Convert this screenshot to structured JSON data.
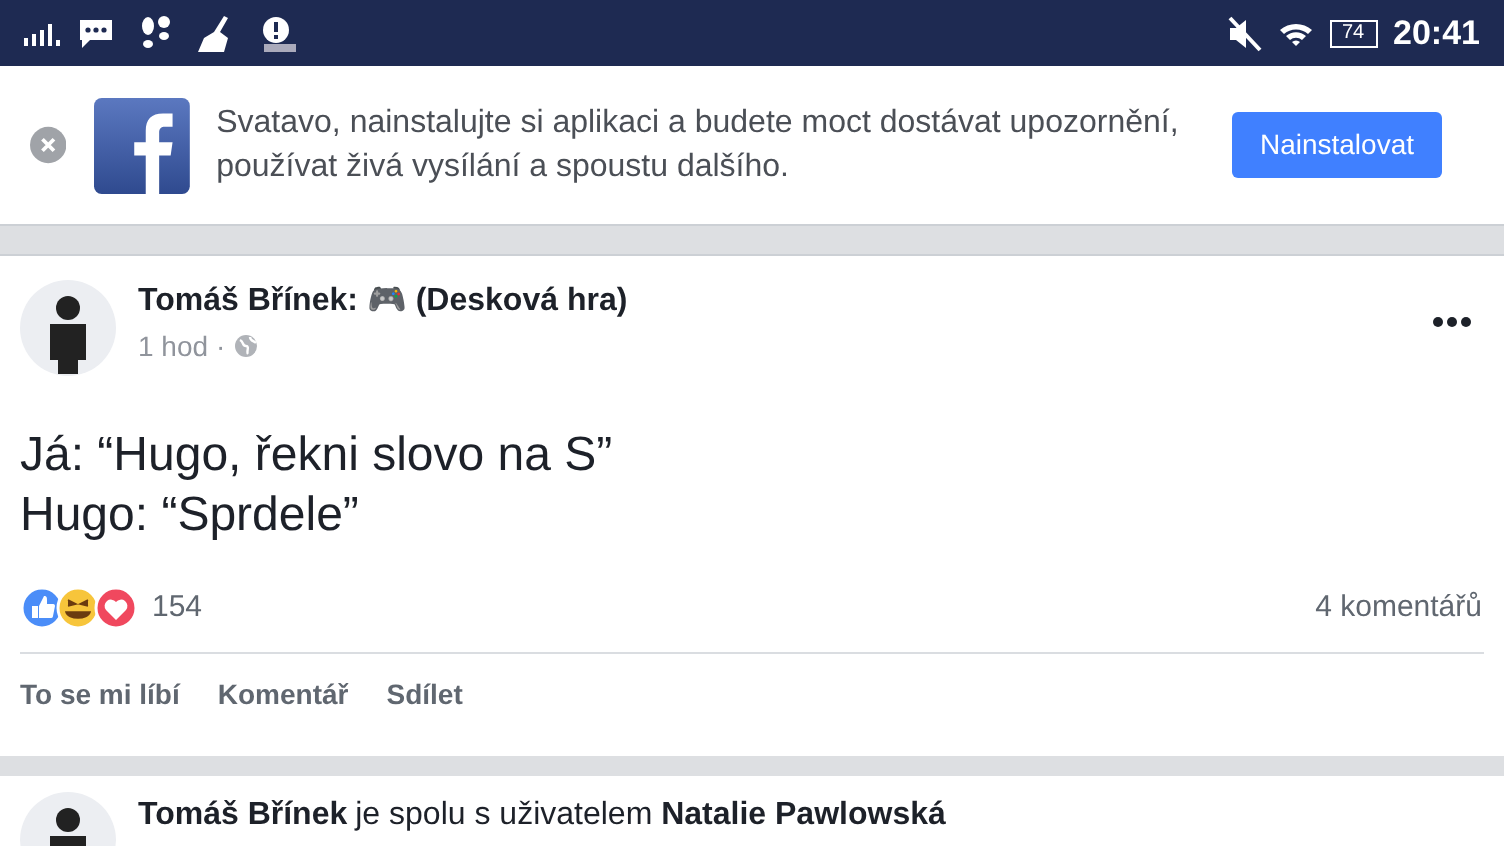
{
  "status_bar": {
    "battery": "74",
    "time": "20:41"
  },
  "install_banner": {
    "message": "Svatavo, nainstalujte si aplikaci a budete moct dostávat upozornění, používat živá vysílání a spoustu dalšího.",
    "button": "Nainstalovat"
  },
  "posts": [
    {
      "author": "Tomáš Břínek",
      "activity": ": 🎮 (Desková hra)",
      "time": "1 hod",
      "separator": "·",
      "text": "Já: “Hugo, řekni slovo na S”\nHugo: “Sprdele”",
      "reaction_count": "154",
      "comments": "4 komentářů",
      "actions": [
        "To se mi líbí",
        "Komentář",
        "Sdílet"
      ]
    },
    {
      "author": "Tomáš Břínek",
      "activity": "je spolu s uživatelem **Natalie Pawlowská**"
    }
  ]
}
